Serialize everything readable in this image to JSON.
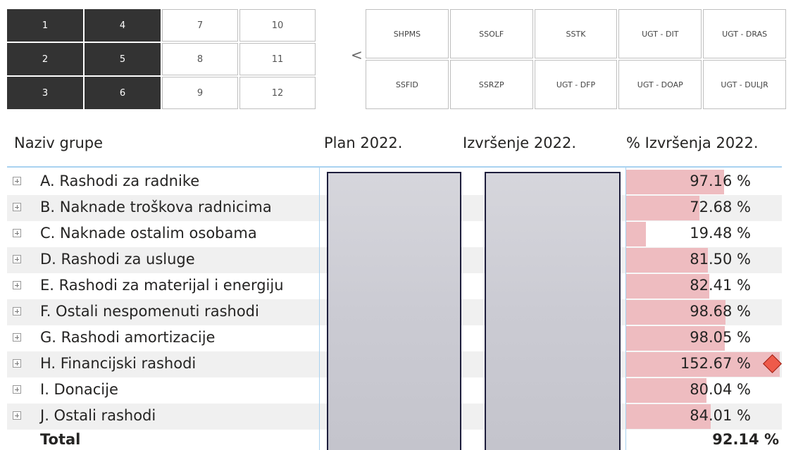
{
  "month_slicer": {
    "items": [
      {
        "label": "1",
        "selected": true
      },
      {
        "label": "2",
        "selected": true
      },
      {
        "label": "3",
        "selected": true
      },
      {
        "label": "4",
        "selected": true
      },
      {
        "label": "5",
        "selected": true
      },
      {
        "label": "6",
        "selected": true
      },
      {
        "label": "7",
        "selected": false
      },
      {
        "label": "8",
        "selected": false
      },
      {
        "label": "9",
        "selected": false
      },
      {
        "label": "10",
        "selected": false
      },
      {
        "label": "11",
        "selected": false
      },
      {
        "label": "12",
        "selected": false
      }
    ]
  },
  "unit_slicer": {
    "scroll_left_glyph": "<",
    "items": [
      "SHPMS",
      "SSOLF",
      "SSTK",
      "UGT - DIT",
      "UGT - DRAS",
      "SSFID",
      "SSRZP",
      "UGT - DFP",
      "UGT - DOAP",
      "UGT - DULJR"
    ]
  },
  "table": {
    "headers": {
      "group": "Naziv grupe",
      "plan": "Plan 2022.",
      "actual": "Izvršenje 2022.",
      "percent": "% Izvršenja 2022."
    },
    "rows": [
      {
        "label": "A. Rashodi za radnike",
        "percent_text": "97.16 %",
        "percent": 97.16
      },
      {
        "label": "B. Naknade troškova radnicima",
        "percent_text": "72.68 %",
        "percent": 72.68
      },
      {
        "label": "C. Naknade ostalim osobama",
        "percent_text": "19.48 %",
        "percent": 19.48
      },
      {
        "label": "D. Rashodi za usluge",
        "percent_text": "81.50 %",
        "percent": 81.5
      },
      {
        "label": "E. Rashodi za materijal i energiju",
        "percent_text": "82.41 %",
        "percent": 82.41
      },
      {
        "label": "F. Ostali nespomenuti rashodi",
        "percent_text": "98.68 %",
        "percent": 98.68
      },
      {
        "label": "G. Rashodi amortizacije",
        "percent_text": "98.05 %",
        "percent": 98.05
      },
      {
        "label": "H. Financijski rashodi",
        "percent_text": "152.67 %",
        "percent": 152.67,
        "warning_icon": "red-diamond-icon"
      },
      {
        "label": "I. Donacije",
        "percent_text": "80.04 %",
        "percent": 80.04
      },
      {
        "label": "J. Ostali rashodi",
        "percent_text": "84.01 %",
        "percent": 84.01
      }
    ],
    "total": {
      "label": "Total",
      "percent_text": "92.14 %"
    }
  },
  "colors": {
    "selected_slicer": "#333333",
    "data_bar": "#eebcc0",
    "warning": "#ee5a4a",
    "row_alt": "#f0f0f0",
    "grid_line": "#a9d2f0"
  }
}
